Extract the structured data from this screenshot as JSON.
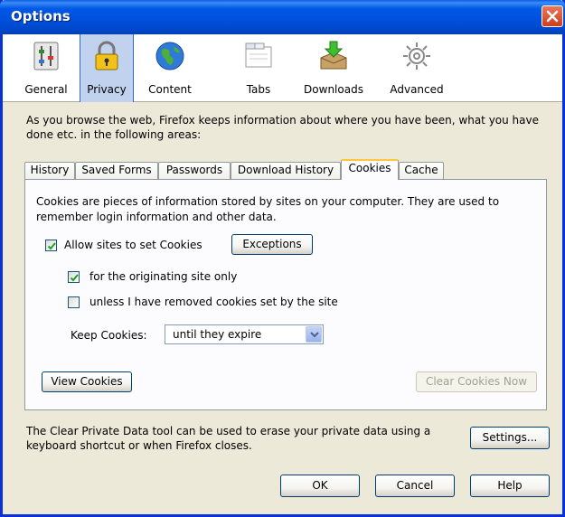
{
  "window": {
    "title": "Options"
  },
  "toolbar": {
    "items": [
      {
        "label": "General",
        "icon": "general-icon"
      },
      {
        "label": "Privacy",
        "icon": "lock-icon",
        "selected": true
      },
      {
        "label": "Content",
        "icon": "globe-icon"
      },
      {
        "label": "Tabs",
        "icon": "tabs-icon"
      },
      {
        "label": "Downloads",
        "icon": "download-icon"
      },
      {
        "label": "Advanced",
        "icon": "gear-icon"
      }
    ]
  },
  "privacy": {
    "intro": "As you browse the web, Firefox keeps information about where you have been, what you have done etc. in the following areas:",
    "tabs": [
      "History",
      "Saved Forms",
      "Passwords",
      "Download History",
      "Cookies",
      "Cache"
    ],
    "active_tab": "Cookies",
    "cookies": {
      "description": "Cookies are pieces of information stored by sites on your computer. They are used to remember login information and other data.",
      "allow_label": "Allow sites to set Cookies",
      "allow_checked": true,
      "exceptions_label": "Exceptions",
      "originating_label": "for the originating site only",
      "originating_checked": true,
      "unless_label": "unless I have removed cookies set by the site",
      "unless_checked": false,
      "keep_label": "Keep Cookies:",
      "keep_value": "until they expire",
      "view_label": "View Cookies",
      "clear_label": "Clear Cookies Now"
    },
    "footer_text": "The Clear Private Data tool can be used to erase your private data using a keyboard shortcut or when Firefox closes.",
    "settings_label": "Settings..."
  },
  "dialog_buttons": {
    "ok": "OK",
    "cancel": "Cancel",
    "help": "Help"
  },
  "colors": {
    "titlebar": "#0054e3",
    "face": "#ece9d8",
    "selected_toolbar": "#c1d2ee",
    "tab_highlight": "#ffc83c"
  }
}
